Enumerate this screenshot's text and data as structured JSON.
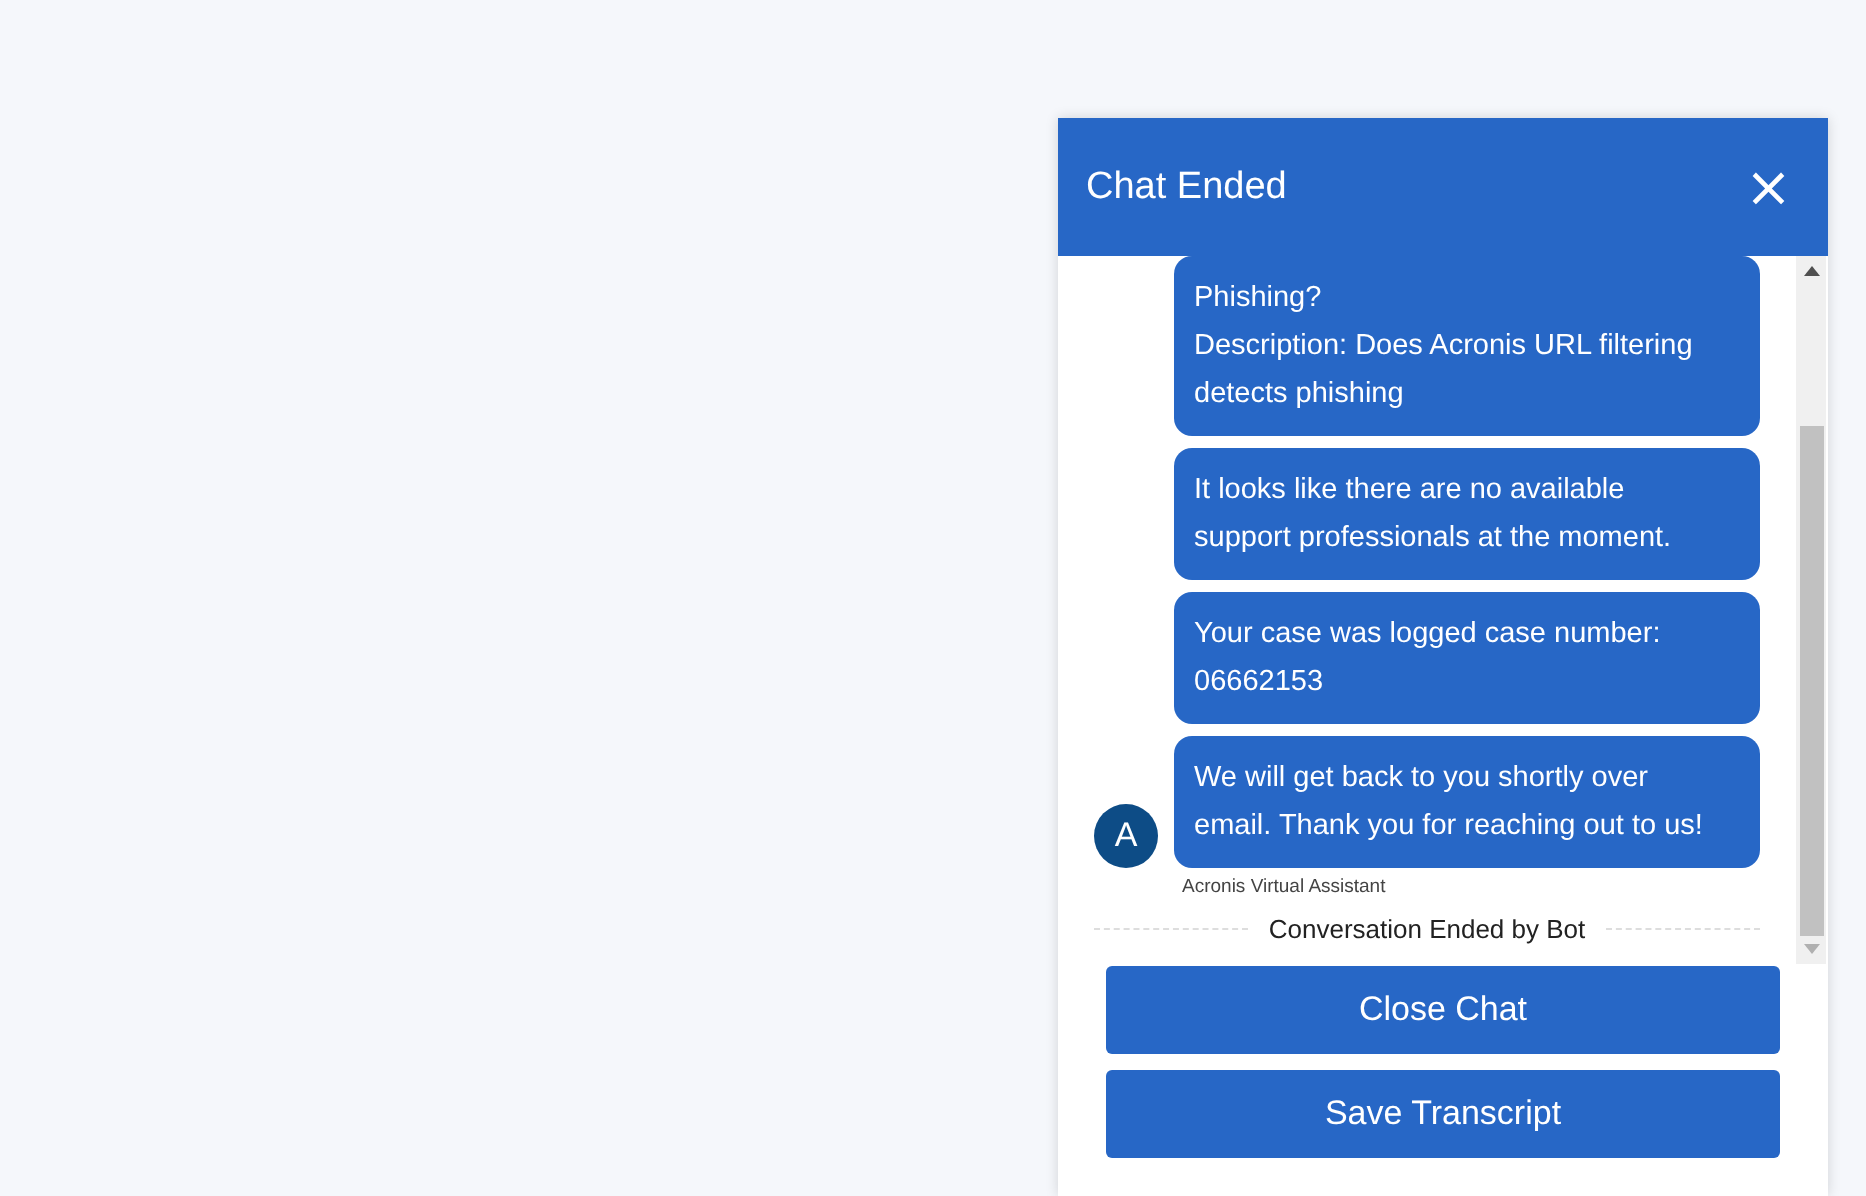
{
  "header": {
    "title": "Chat Ended",
    "close": "×"
  },
  "messages": [
    {
      "text": "Phishing?\nDescription: Does Acronis URL filtering detects phishing"
    },
    {
      "text": "It looks like there are no available support professionals at the moment."
    },
    {
      "text": "Your case was logged case number: 06662153"
    },
    {
      "text": "We will get back to you shortly over email. Thank you for reaching out to us!"
    }
  ],
  "avatar": {
    "initial": "A"
  },
  "sender": "Acronis Virtual Assistant",
  "divider": "Conversation Ended by Bot",
  "buttons": [
    "Close Chat",
    "Save Transcript"
  ]
}
